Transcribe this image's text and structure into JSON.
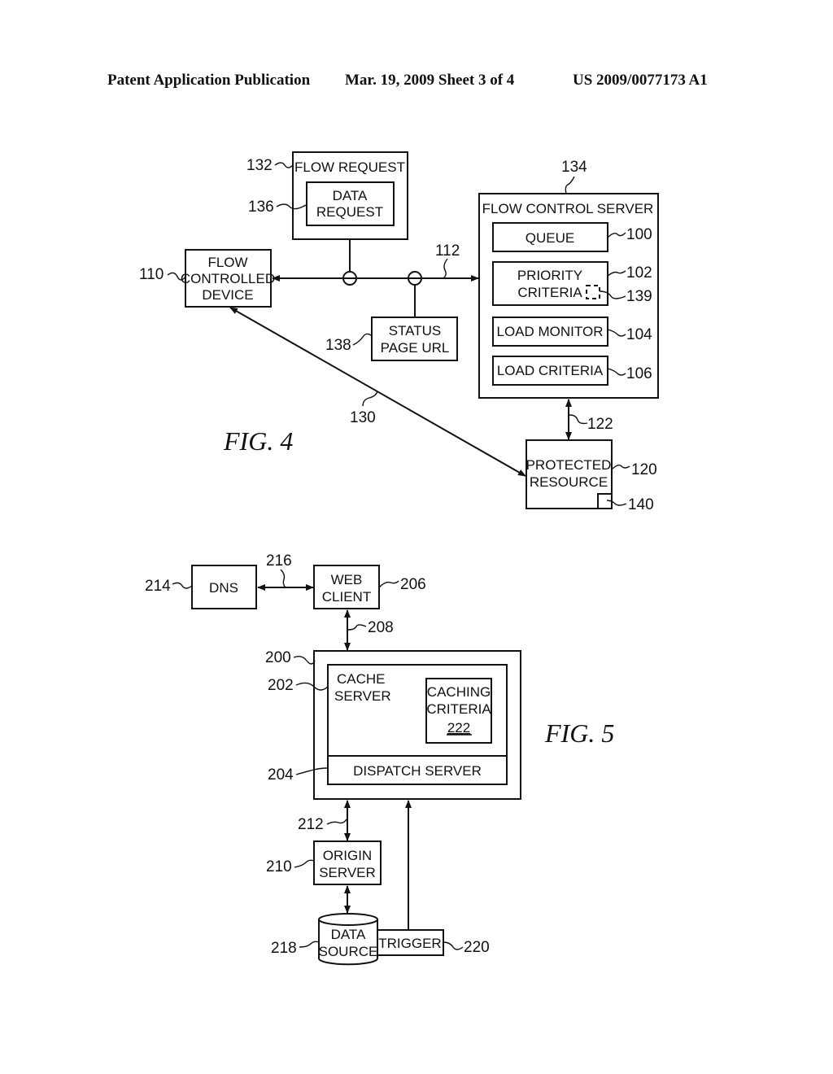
{
  "header": {
    "left": "Patent Application Publication",
    "middle": "Mar. 19, 2009  Sheet 3 of 4",
    "right": "US 2009/0077173 A1"
  },
  "fig4": {
    "caption": "FIG.  4",
    "flow_request": {
      "title": "FLOW REQUEST",
      "ref": "132"
    },
    "data_request": {
      "line1": "DATA",
      "line2": "REQUEST",
      "ref": "136"
    },
    "flow_controlled_device": {
      "line1": "FLOW",
      "line2": "CONTROLLED",
      "line3": "DEVICE",
      "ref": "110"
    },
    "status_page_url": {
      "line1": "STATUS",
      "line2": "PAGE  URL",
      "ref": "138"
    },
    "link_112": "112",
    "flow_control_server": {
      "title": "FLOW  CONTROL  SERVER",
      "ref": "134"
    },
    "queue": {
      "label": "QUEUE",
      "ref": "100"
    },
    "priority_criteria": {
      "line1": "PRIORITY",
      "line2": "CRITERIA",
      "ref": "102",
      "inner_ref": "139"
    },
    "load_monitor": {
      "label": "LOAD  MONITOR",
      "ref": "104"
    },
    "load_criteria": {
      "label": "LOAD  CRITERIA",
      "ref": "106"
    },
    "link_122": "122",
    "link_130": "130",
    "protected_resource": {
      "line1": "PROTECTED",
      "line2": "RESOURCE",
      "ref": "120",
      "inner_ref": "140"
    }
  },
  "fig5": {
    "caption": "FIG.  5",
    "dns": {
      "label": "DNS",
      "ref": "214"
    },
    "link_216": "216",
    "web_client": {
      "line1": "WEB",
      "line2": "CLIENT",
      "ref": "206"
    },
    "link_208": "208",
    "outer": {
      "ref": "200"
    },
    "cache_server": {
      "line1": "CACHE",
      "line2": "SERVER",
      "ref": "202"
    },
    "caching_criteria": {
      "line1": "CACHING",
      "line2": "CRITERIA",
      "line3": "222"
    },
    "dispatch_server": {
      "label": "DISPATCH  SERVER",
      "ref": "204"
    },
    "link_212": "212",
    "origin_server": {
      "line1": "ORIGIN",
      "line2": "SERVER",
      "ref": "210"
    },
    "data_source": {
      "line1": "DATA",
      "line2": "SOURCE",
      "ref": "218"
    },
    "trigger": {
      "label": "TRIGGER",
      "ref": "220"
    }
  }
}
